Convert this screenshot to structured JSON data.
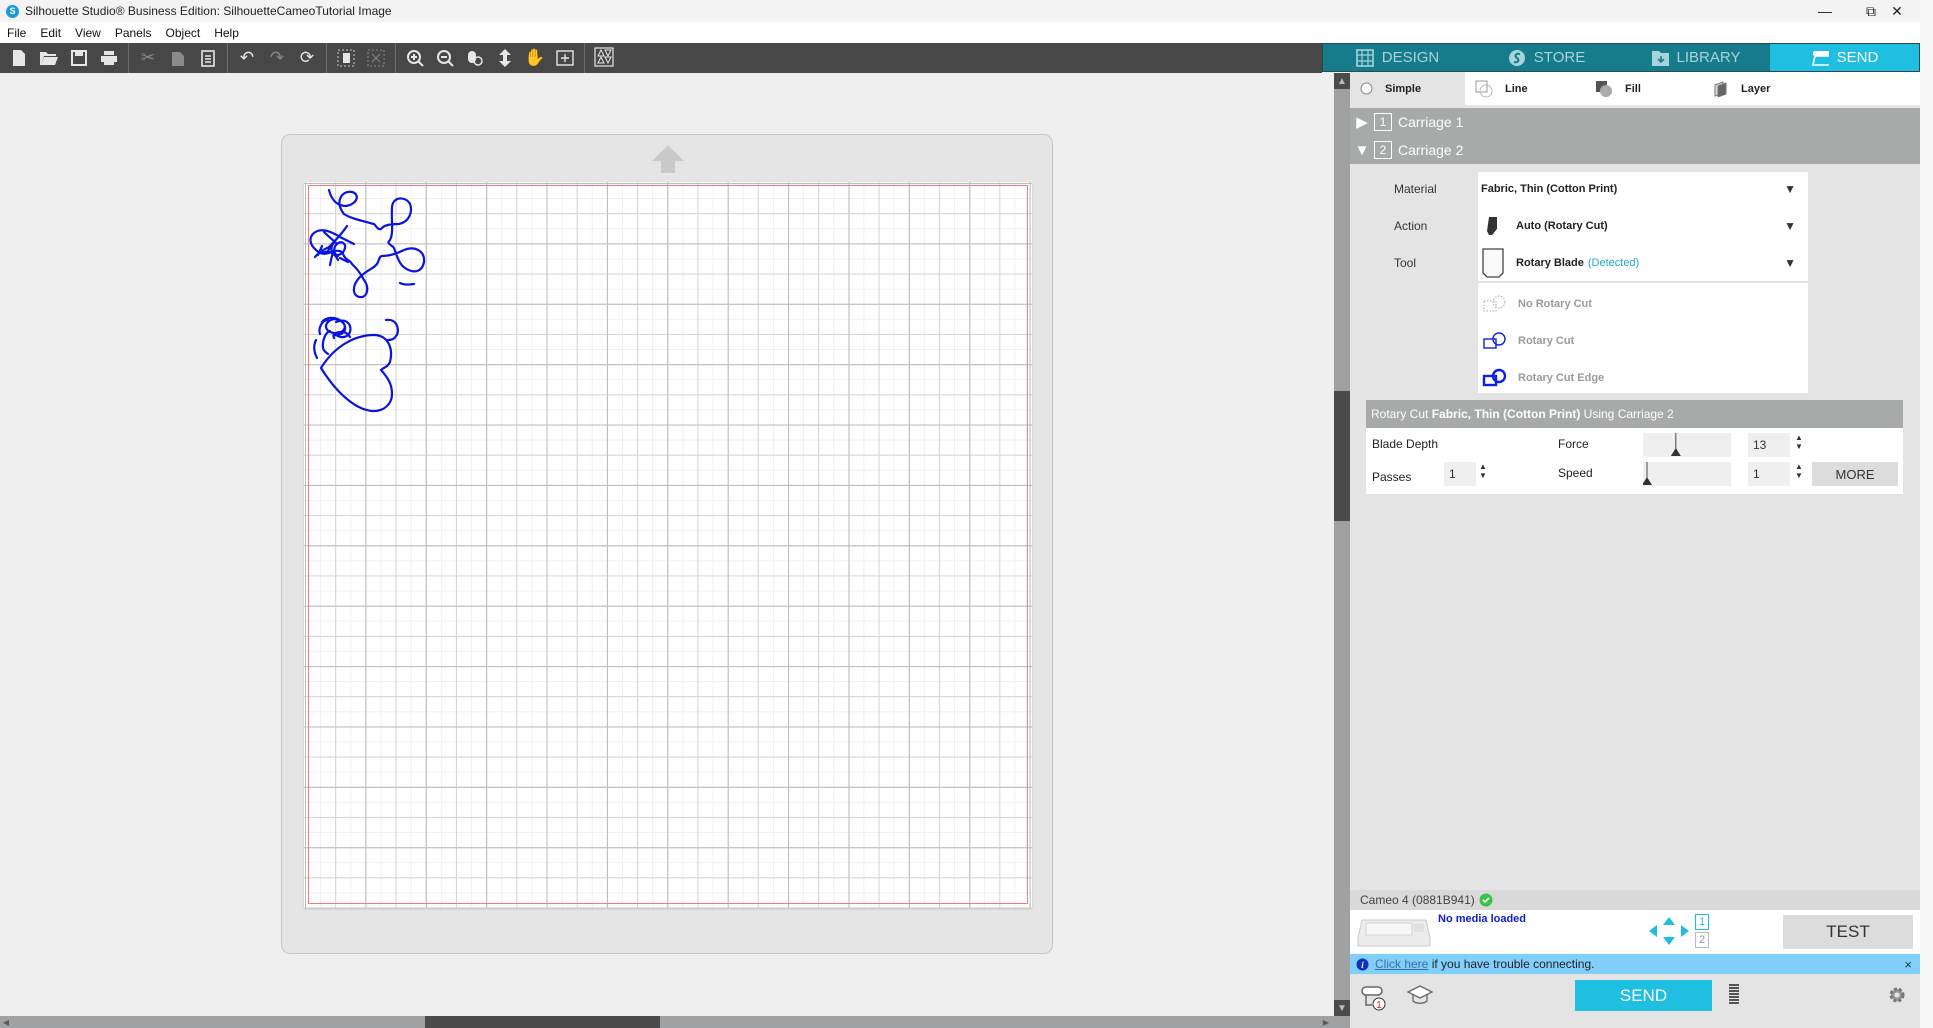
{
  "window": {
    "title": "Silhouette Studio® Business Edition: SilhouetteCameoTutorial Image",
    "controls": {
      "minimize": "—",
      "maximize": "⧉",
      "close": "✕"
    }
  },
  "menu": [
    "File",
    "Edit",
    "View",
    "Panels",
    "Object",
    "Help"
  ],
  "toolbar": {
    "groups": [
      [
        "new-document-icon",
        "open-folder-icon",
        "save-icon",
        "print-icon"
      ],
      [
        "cut-icon",
        "copy-icon",
        "paste-icon"
      ],
      [
        "undo-icon",
        "redo-icon",
        "redraw-icon"
      ],
      [
        "select-all-icon",
        "deselect-icon"
      ],
      [
        "zoom-in-icon",
        "zoom-out-icon",
        "zoom-select-icon",
        "pan-drag-icon",
        "hand-icon",
        "fit-to-page-icon"
      ],
      [
        "trace-icon"
      ]
    ]
  },
  "tabs": [
    {
      "label": "DESIGN",
      "icon": "grid-icon",
      "active": false
    },
    {
      "label": "STORE",
      "icon": "silhouette-s-icon",
      "active": false
    },
    {
      "label": "LIBRARY",
      "icon": "library-download-icon",
      "active": false
    },
    {
      "label": "SEND",
      "icon": "cutter-icon",
      "active": true
    }
  ],
  "send_modes": [
    {
      "label": "Simple",
      "icon": "radio-icon",
      "active": true
    },
    {
      "label": "Line",
      "icon": "line-mode-icon",
      "active": false
    },
    {
      "label": "Fill",
      "icon": "fill-mode-icon",
      "active": false
    },
    {
      "label": "Layer",
      "icon": "layer-mode-icon",
      "active": false
    }
  ],
  "carriages": [
    {
      "number": "1",
      "label": "Carriage 1",
      "expanded": false
    },
    {
      "number": "2",
      "label": "Carriage 2",
      "expanded": true
    }
  ],
  "fields": {
    "material_label": "Material",
    "material_value": "Fabric, Thin (Cotton Print)",
    "action_label": "Action",
    "action_value": "Auto (Rotary Cut)",
    "tool_label": "Tool",
    "tool_value": "Rotary Blade",
    "tool_status": "(Detected)"
  },
  "action_options": [
    {
      "label": "No Rotary Cut",
      "icon": "no-rotary-cut-icon"
    },
    {
      "label": "Rotary Cut",
      "icon": "rotary-cut-icon"
    },
    {
      "label": "Rotary Cut Edge",
      "icon": "rotary-cut-edge-icon"
    }
  ],
  "settings": {
    "header_prefix": "Rotary Cut ",
    "header_material": "Fabric, Thin (Cotton Print)",
    "header_suffix": " Using Carriage 2",
    "blade_depth_label": "Blade Depth",
    "passes_label": "Passes",
    "passes_value": "1",
    "force_label": "Force",
    "force_value": "13",
    "force_fraction": 0.36,
    "speed_label": "Speed",
    "speed_value": "1",
    "speed_fraction": 0.0,
    "more_label": "MORE"
  },
  "device": {
    "name": "Cameo 4 (0881B941)",
    "connected": true,
    "media_status": "No media loaded",
    "carriage_select": [
      "1",
      "2"
    ],
    "test_label": "TEST"
  },
  "info_bar": {
    "link": "Click here",
    "text": " if you have trouble connecting.",
    "close": "×"
  },
  "bottom": {
    "send_label": "SEND",
    "queue_badge": "1"
  },
  "colors": {
    "accent": "#1ebfe0",
    "tab_bar": "#167b8a",
    "sketch_stroke": "#0a14e0",
    "cut_border": "#ef7d7d"
  }
}
